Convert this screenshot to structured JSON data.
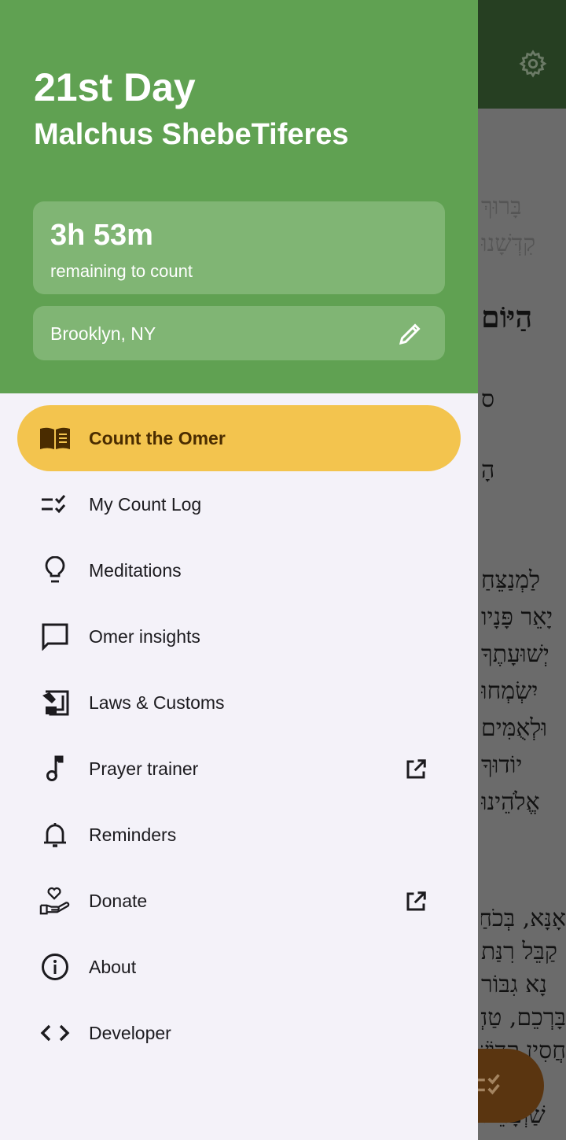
{
  "header": {
    "day": "21st Day",
    "sefira": "Malchus ShebeTiferes",
    "time_remaining": "3h 53m",
    "time_caption": "remaining to count",
    "location": "Brooklyn, NY"
  },
  "menu": [
    {
      "label": "Count the Omer",
      "icon": "book-icon",
      "active": true
    },
    {
      "label": "My Count Log",
      "icon": "checklist-icon"
    },
    {
      "label": "Meditations",
      "icon": "lightbulb-icon"
    },
    {
      "label": "Omer insights",
      "icon": "chat-bubble-icon"
    },
    {
      "label": "Laws & Customs",
      "icon": "gavel-icon"
    },
    {
      "label": "Prayer trainer",
      "icon": "music-note-icon",
      "external": true
    },
    {
      "label": "Reminders",
      "icon": "bell-icon"
    },
    {
      "label": "Donate",
      "icon": "heart-hand-icon",
      "external": true
    },
    {
      "label": "About",
      "icon": "info-icon"
    },
    {
      "label": "Developer",
      "icon": "code-icon"
    }
  ],
  "background": {
    "lines": [
      "בָּרוּךְ",
      "קִדְּשָׁנוּ",
      "הַיּוֹם",
      "ס",
      "הָ",
      "לַמְנַצֵּחַ",
      "יָאֵר פָּנָיו",
      "יְשׁוּעָתֶךָ",
      "יִשְׂמְחוּ",
      "וּלְאֻמִּים",
      "יוֹדוּךָ",
      "אֱלֹהֵינוּ",
      "אָנָּא, בְּכֹחַ",
      "קַבֵּל רִנַּת",
      "נָא גִבּוֹר",
      "בָּרְכֵם, טַהֲרֵם",
      "חֲסִין קָדוֹשׁ",
      "שַׁוְעָתֵנוּ"
    ]
  },
  "colors": {
    "header": "#60a152",
    "active": "#f3c44e",
    "toolbar": "#263f22"
  }
}
